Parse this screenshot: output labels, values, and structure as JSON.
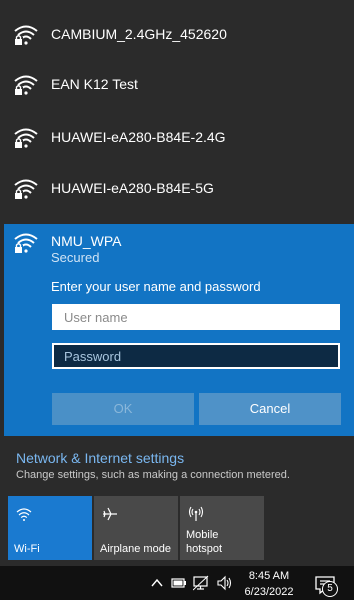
{
  "networks": [
    {
      "ssid": "CAMBIUM_2.4GHz_452620",
      "secured": true
    },
    {
      "ssid": "EAN K12 Test",
      "secured": true
    },
    {
      "ssid": "HUAWEI-eA280-B84E-2.4G",
      "secured": true
    },
    {
      "ssid": "HUAWEI-eA280-B84E-5G",
      "secured": true
    }
  ],
  "connecting": {
    "ssid": "NMU_WPA",
    "status": "Secured",
    "prompt": "Enter your user name and password",
    "username_placeholder": "User name",
    "password_placeholder": "Password",
    "ok_label": "OK",
    "cancel_label": "Cancel"
  },
  "settings": {
    "title": "Network & Internet settings",
    "description": "Change settings, such as making a connection metered."
  },
  "quick_actions": [
    {
      "label": "Wi-Fi",
      "icon": "wifi-icon",
      "active": true
    },
    {
      "label": "Airplane mode",
      "icon": "airplane-icon",
      "active": false
    },
    {
      "label": "Mobile\nhotspot",
      "icon": "hotspot-icon",
      "active": false
    }
  ],
  "taskbar": {
    "time": "8:45 AM",
    "date": "6/23/2022",
    "notification_count": "5",
    "icons": [
      "chevron-up-icon",
      "battery-icon",
      "network-icon",
      "volume-icon"
    ]
  },
  "colors": {
    "accent": "#1274c4",
    "link": "#7ab7f0",
    "background": "#2b2b2b",
    "taskbar": "#111111"
  }
}
